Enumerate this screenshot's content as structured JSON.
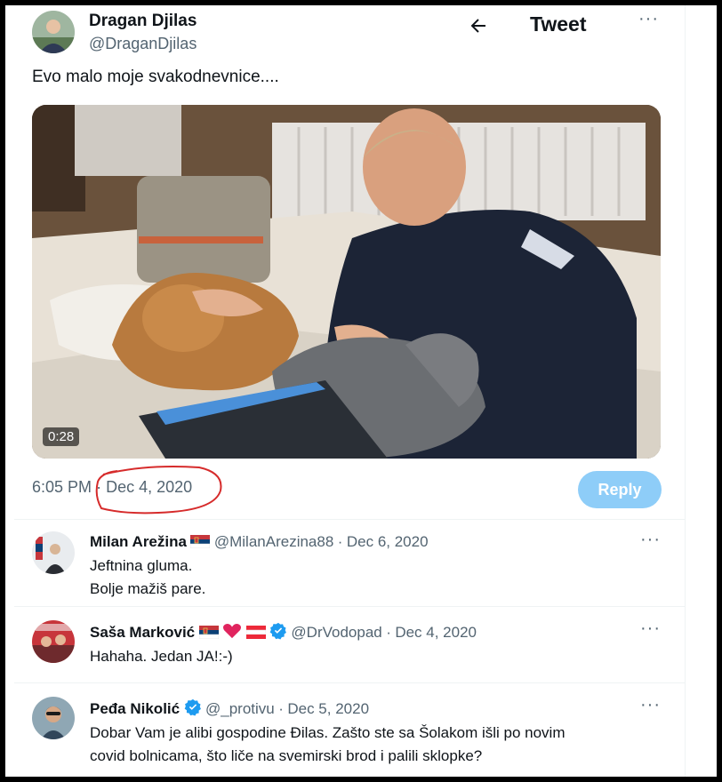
{
  "header": {
    "title": "Tweet",
    "back_icon": "arrow-left-icon",
    "more_icon": "more-dots-icon"
  },
  "tweet": {
    "author_name": "Dragan Djilas",
    "author_handle": "@DraganDjilas",
    "text": "Evo malo moje svakodnevnice....",
    "video_duration": "0:28",
    "time": "6:05 PM",
    "separator": "·",
    "date": "Dec 4, 2020"
  },
  "composer": {
    "reply_label": "Reply"
  },
  "replies": [
    {
      "name": "Milan Arežina",
      "handle": "@MilanArezina88",
      "separator": "·",
      "date": "Dec 6, 2020",
      "lines": [
        "Jeftnina gluma.",
        "Bolje mažiš pare."
      ]
    },
    {
      "name": "Saša Marković",
      "handle": "@DrVodopad",
      "separator": "·",
      "date": "Dec 4, 2020",
      "lines": [
        "Hahaha. Jedan JA!:-)"
      ]
    },
    {
      "name": "Peđa Nikolić",
      "handle": "@_protivu",
      "separator": "·",
      "date": "Dec 5, 2020",
      "lines": [
        "Dobar Vam je alibi gospodine Đilas. Zašto ste sa Šolakom išli po novim",
        "covid bolnicama, što liče na svemirski brod i palili sklopke?"
      ]
    }
  ],
  "colors": {
    "accent": "#1d9bf0",
    "reply_button": "#8ecdf8",
    "secondary_text": "#536471",
    "annotation_circle": "#d62b2b"
  }
}
